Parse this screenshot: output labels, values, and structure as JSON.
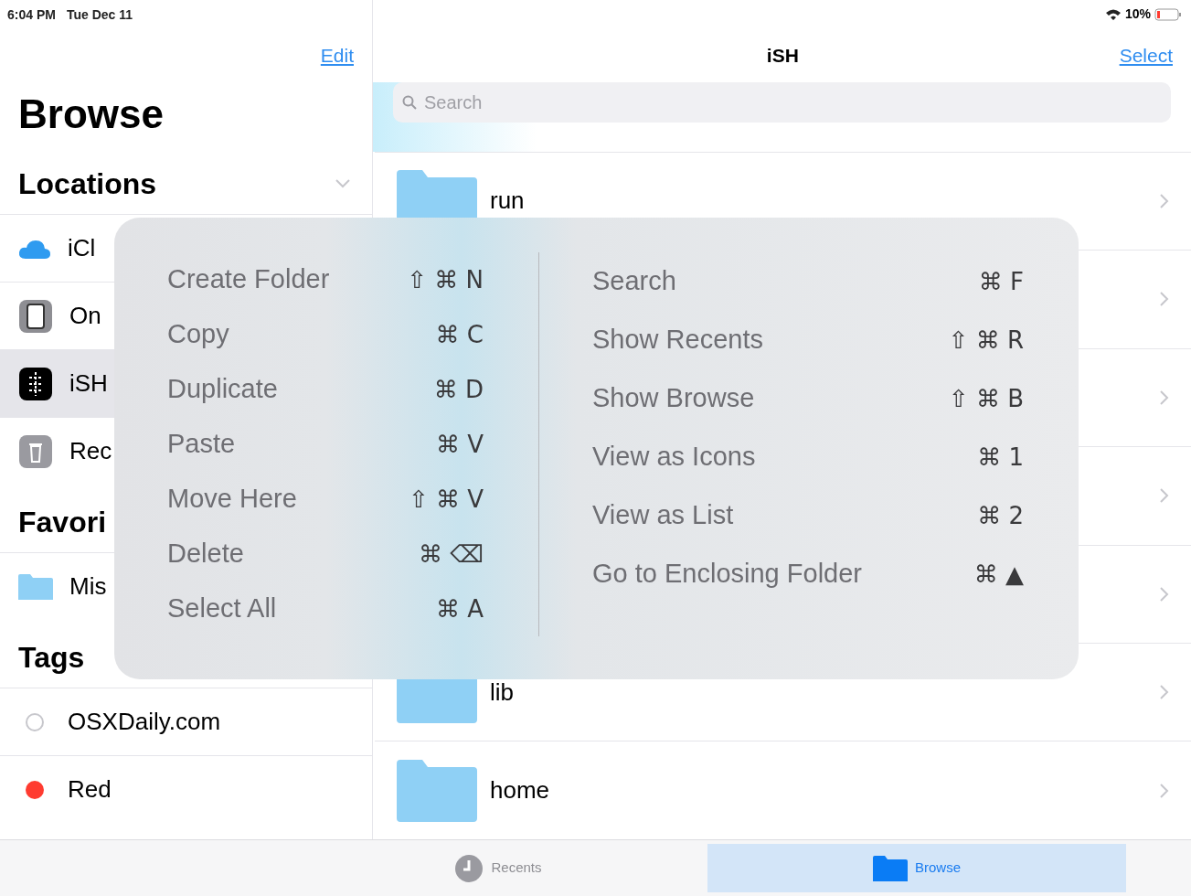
{
  "status_bar": {
    "time": "6:04 PM",
    "date": "Tue Dec 11",
    "battery": "10%"
  },
  "sidebar": {
    "edit": "Edit",
    "title": "Browse",
    "sections": [
      {
        "title": "Locations",
        "items": [
          {
            "label": "iCl",
            "kind": "cloud",
            "selected": false
          },
          {
            "label": "On",
            "kind": "device",
            "selected": false
          },
          {
            "label": "iSH",
            "kind": "app",
            "selected": true
          },
          {
            "label": "Rec",
            "kind": "trash",
            "selected": false
          }
        ]
      },
      {
        "title": "Favori",
        "items": [
          {
            "label": "Mis",
            "kind": "folder",
            "selected": false
          }
        ]
      },
      {
        "title": "Tags",
        "items": [
          {
            "label": "OSXDaily.com",
            "kind": "tag",
            "selected": false
          },
          {
            "label": "Red",
            "kind": "tag",
            "color": "#ff3b30",
            "selected": false
          }
        ]
      }
    ]
  },
  "main": {
    "title": "iSH",
    "select": "Select",
    "search": {
      "placeholder": "Search"
    },
    "folders": [
      {
        "kind": "named",
        "name": "run"
      },
      {
        "kind": "covered"
      },
      {
        "kind": "covered"
      },
      {
        "kind": "covered"
      },
      {
        "kind": "covered"
      },
      {
        "kind": "named",
        "name": "lib"
      },
      {
        "kind": "named",
        "name": "home"
      }
    ]
  },
  "shortcut_menu": {
    "columns": [
      [
        {
          "label": "Create Folder",
          "shortcut": "⇧ ⌘ N"
        },
        {
          "label": "Copy",
          "shortcut": "⌘ C"
        },
        {
          "label": "Duplicate",
          "shortcut": "⌘ D"
        },
        {
          "label": "Paste",
          "shortcut": "⌘ V"
        },
        {
          "label": "Move Here",
          "shortcut": "⇧ ⌘ V"
        },
        {
          "label": "Delete",
          "shortcut": "⌘ ⌫"
        },
        {
          "label": "Select All",
          "shortcut": "⌘ A"
        }
      ],
      [
        {
          "label": "Search",
          "shortcut": "⌘ F"
        },
        {
          "label": "Show Recents",
          "shortcut": "⇧ ⌘ R"
        },
        {
          "label": "Show Browse",
          "shortcut": "⇧ ⌘ B"
        },
        {
          "label": "View as Icons",
          "shortcut": "⌘ 1"
        },
        {
          "label": "View as List",
          "shortcut": "⌘ 2"
        },
        {
          "label": "Go to Enclosing Folder",
          "shortcut": "⌘ ▲"
        }
      ]
    ]
  },
  "tab_bar": [
    {
      "label": "Recents",
      "kind": "clock",
      "selected": false
    },
    {
      "label": "Browse",
      "kind": "folder",
      "selected": true
    }
  ]
}
